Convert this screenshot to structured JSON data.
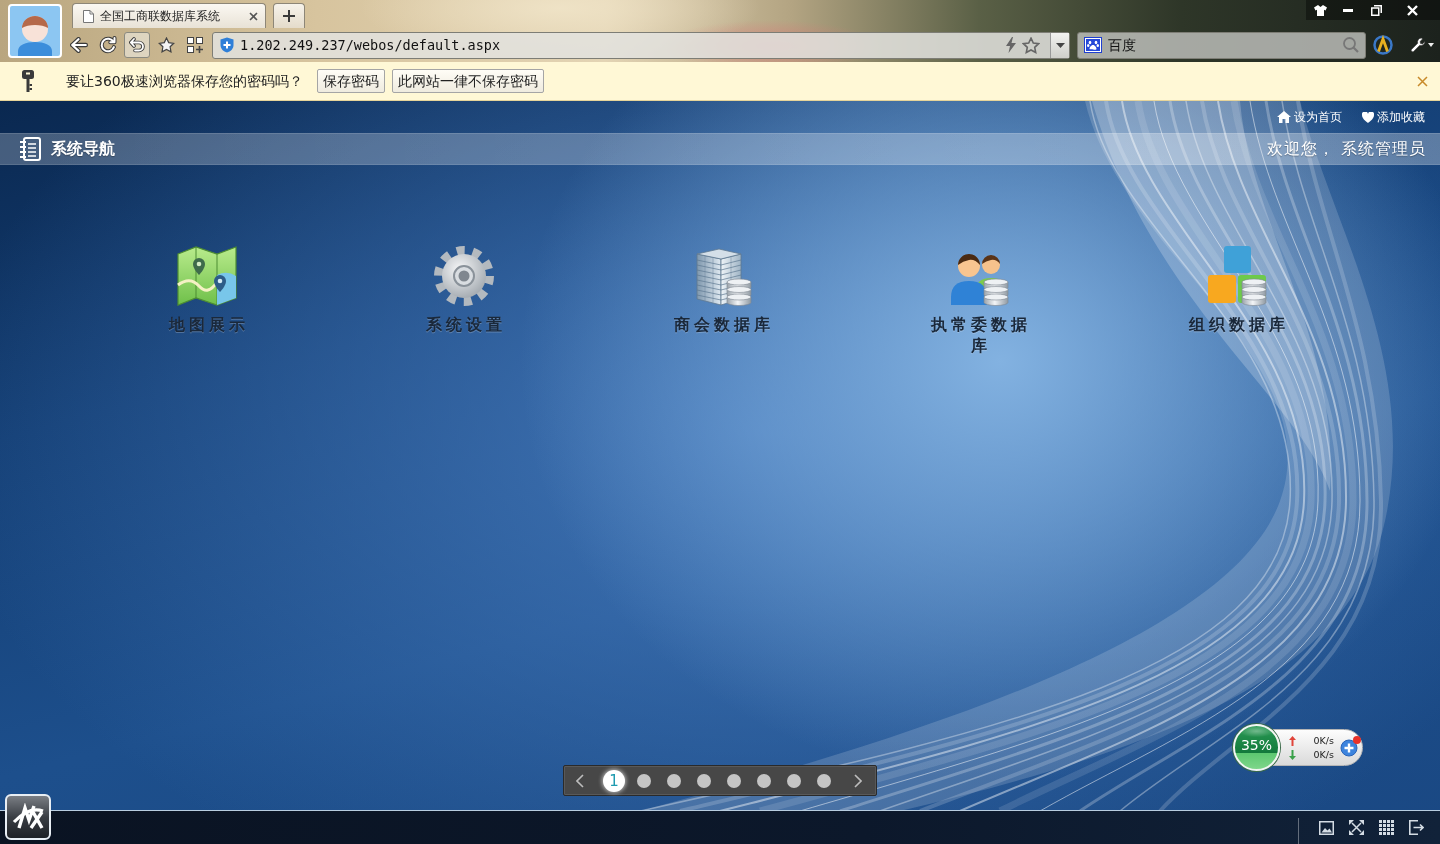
{
  "browser": {
    "tabs": [
      {
        "title": "全国工商联数据库系统",
        "selected": true
      }
    ],
    "address": "1.202.249.237/webos/default.aspx",
    "search_engine": "百度"
  },
  "password_prompt": {
    "message": "要让360极速浏览器保存您的密码吗？",
    "buttons": [
      "保存密码",
      "此网站一律不保存密码"
    ]
  },
  "top_links": [
    {
      "label": "设为首页",
      "kind": "home"
    },
    {
      "label": "添加收藏",
      "kind": "favorite"
    }
  ],
  "header": {
    "title": "系统导航",
    "greeting": "欢迎您， 系统管理员"
  },
  "desktop_icons": [
    {
      "label": "地图展示",
      "kind": "map"
    },
    {
      "label": "系统设置",
      "kind": "settings"
    },
    {
      "label": "商会数据库",
      "kind": "building"
    },
    {
      "label": "执常委数据库",
      "kind": "people"
    },
    {
      "label": "组织数据库",
      "kind": "blocks"
    }
  ],
  "pager": {
    "pages": [
      {
        "label": "1",
        "selected": true
      },
      {
        "selected": false
      },
      {
        "selected": false
      },
      {
        "selected": false
      },
      {
        "selected": false
      },
      {
        "selected": false
      },
      {
        "selected": false
      },
      {
        "selected": false
      }
    ]
  },
  "network_monitor": {
    "usage": "35%",
    "upload": "0K/s",
    "download": "0K/s"
  }
}
